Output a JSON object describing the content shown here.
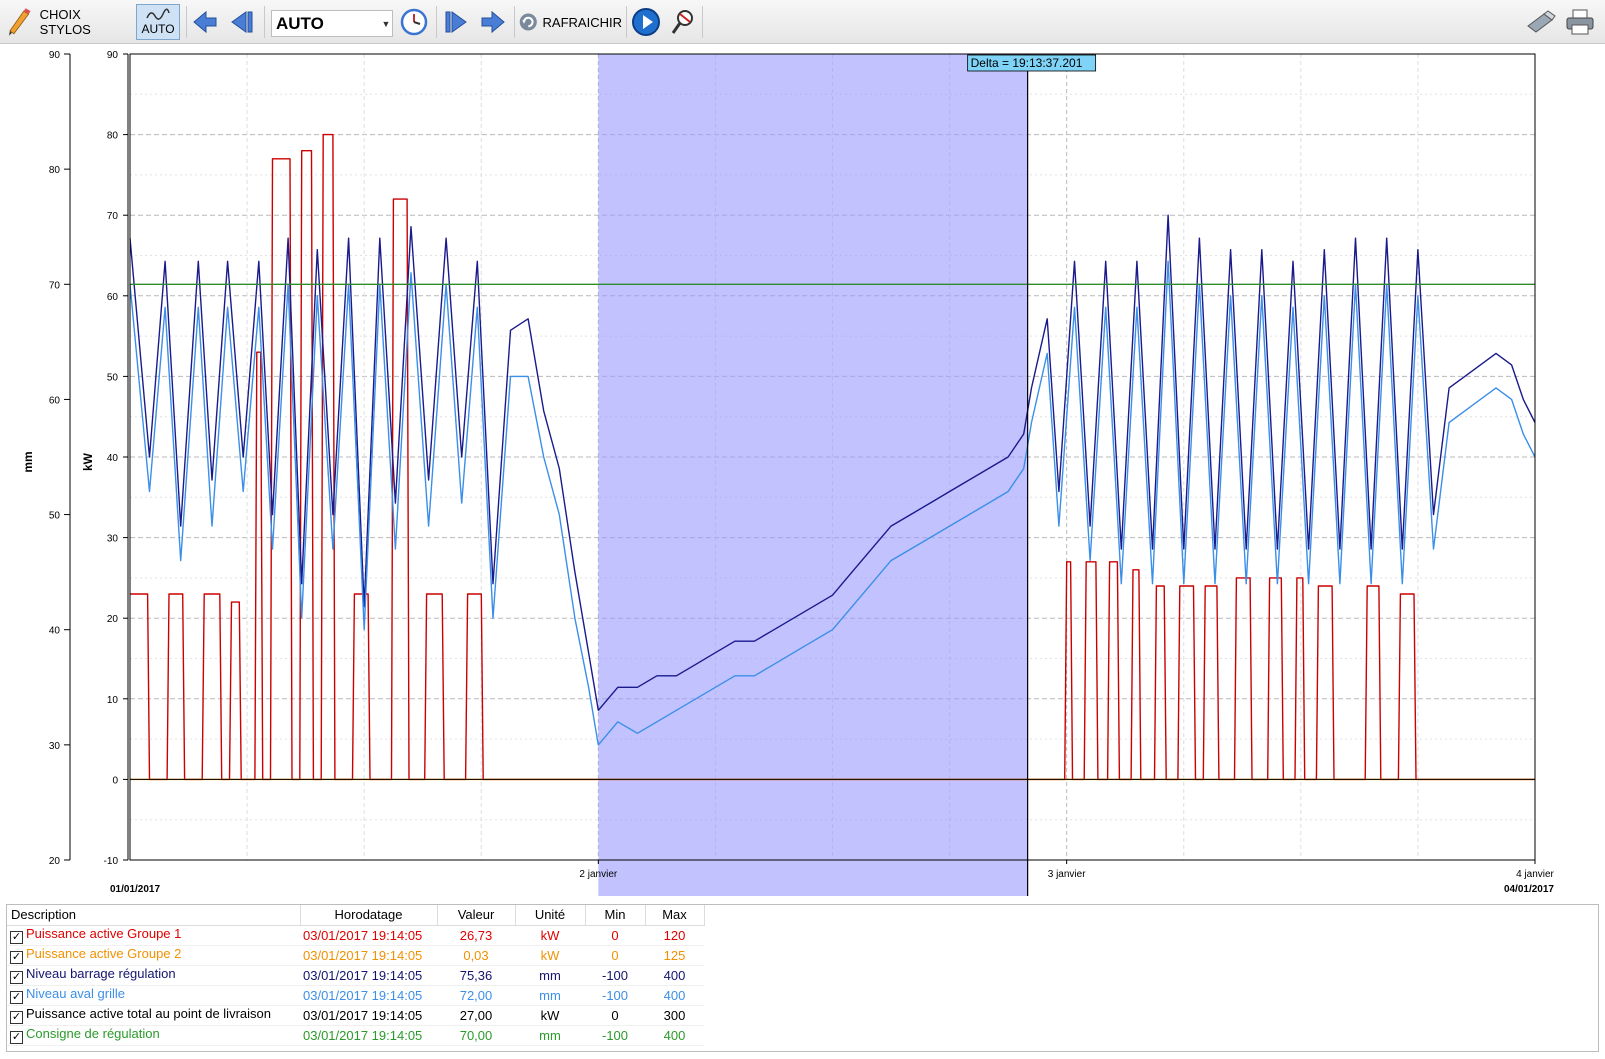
{
  "toolbar": {
    "choose_pens_label": "CHOIX STYLOS",
    "auto_label": "AUTO",
    "mode_value": "AUTO",
    "refresh_label": "RAFRAICHIR"
  },
  "chart_data": {
    "type": "line",
    "title": "",
    "left_axis": {
      "label": "mm",
      "ticks": [
        20,
        30,
        40,
        50,
        60,
        70,
        80,
        90
      ],
      "range": [
        20,
        90
      ]
    },
    "right_axis": {
      "label": "kW",
      "ticks": [
        -10,
        0,
        10,
        20,
        30,
        40,
        50,
        60,
        70,
        80,
        90
      ],
      "range": [
        -10,
        90
      ]
    },
    "x_range_hours": [
      0,
      72
    ],
    "x_tick_labels": [
      "2 janvier",
      "3 janvier",
      "4 janvier"
    ],
    "start_label": "01/01/2017",
    "end_label": "04/01/2017",
    "delta_label": "Delta = 19:13:37.201",
    "selection_hours": [
      24,
      46.0
    ],
    "grid": true,
    "series": [
      {
        "name": "Puissance active Groupe 1",
        "color": "#cc0000",
        "unit": "kW",
        "x": [
          0,
          0.9,
          1,
          1.9,
          2,
          2.7,
          2.8,
          3.7,
          3.8,
          4.6,
          4.7,
          5.1,
          5.2,
          5.6,
          5.7,
          6.4,
          6.5,
          6.7,
          6.8,
          7.2,
          7.3,
          8.2,
          8.3,
          8.7,
          8.8,
          9.3,
          9.4,
          9.8,
          9.9,
          10.4,
          10.5,
          11.4,
          11.5,
          12.2,
          12.3,
          13.4,
          13.5,
          14.2,
          14.3,
          15.1,
          15.2,
          16.0,
          16.1,
          17.2,
          17.3,
          18.0,
          18.1,
          18.4,
          18.5,
          47.9,
          48.0,
          48.2,
          48.3,
          48.9,
          49.0,
          49.5,
          49.6,
          50.1,
          50.2,
          50.6,
          50.7,
          51.3,
          51.4,
          51.7,
          51.8,
          52.5,
          52.6,
          53.0,
          53.1,
          53.7,
          53.8,
          54.5,
          54.6,
          55.0,
          55.1,
          55.7,
          55.8,
          56.6,
          56.7,
          57.4,
          57.5,
          58.3,
          58.4,
          59.0,
          59.1,
          59.7,
          59.8,
          60.1,
          60.2,
          60.8,
          60.9,
          61.6,
          61.7,
          62.5,
          62.6,
          63.3,
          63.4,
          64.0,
          64.1,
          65.0,
          65.1,
          65.8,
          65.9,
          66.6,
          66.7,
          72
        ],
        "y": [
          23,
          23,
          0,
          0,
          23,
          23,
          0,
          0,
          23,
          23,
          0,
          0,
          22,
          22,
          0,
          0,
          53,
          53,
          0,
          0,
          77,
          77,
          0,
          0,
          78,
          78,
          0,
          0,
          80,
          80,
          0,
          0,
          23,
          23,
          0,
          0,
          72,
          72,
          0,
          0,
          23,
          23,
          0,
          0,
          23,
          23,
          0,
          0,
          0,
          0,
          27,
          27,
          0,
          0,
          27,
          27,
          0,
          0,
          27,
          27,
          0,
          0,
          26,
          26,
          0,
          0,
          24,
          24,
          0,
          0,
          24,
          24,
          0,
          0,
          24,
          24,
          0,
          0,
          25,
          25,
          0,
          0,
          25,
          25,
          0,
          0,
          25,
          25,
          0,
          0,
          24,
          24,
          0,
          0,
          0,
          0,
          24,
          24,
          0,
          0,
          23,
          23,
          0,
          0,
          0,
          0
        ]
      },
      {
        "name": "Puissance active Groupe 2",
        "color": "#ff9900",
        "unit": "kW",
        "x": [
          0,
          72
        ],
        "y": [
          0,
          0
        ]
      },
      {
        "name": "Niveau barrage régulation",
        "color": "#1a1a8c",
        "unit": "mm",
        "x": [
          0,
          1,
          1.8,
          2.6,
          3.5,
          4.2,
          5.0,
          5.8,
          6.6,
          7.3,
          8.1,
          8.8,
          9.6,
          10.4,
          11.2,
          12.0,
          12.8,
          13.6,
          14.4,
          15.3,
          16.2,
          17.0,
          17.8,
          18.6,
          19.5,
          20.4,
          21.2,
          22.0,
          22.8,
          23.5,
          24.0,
          25,
          26,
          27,
          28,
          29,
          30,
          31,
          32,
          33,
          34,
          35,
          36,
          37,
          38,
          39,
          40,
          41,
          42,
          43,
          44,
          45,
          45.8,
          46.2,
          47.0,
          47.6,
          48.4,
          49.2,
          50.0,
          50.8,
          51.6,
          52.4,
          53.2,
          54.0,
          54.8,
          55.6,
          56.4,
          57.2,
          58.0,
          58.8,
          59.6,
          60.4,
          61.2,
          62.0,
          62.8,
          63.6,
          64.4,
          65.2,
          66.0,
          66.8,
          67.6,
          68.4,
          69.2,
          70.0,
          70.8,
          71.4,
          72.0
        ],
        "y": [
          74,
          55,
          72,
          49,
          72,
          53,
          72,
          55,
          72,
          50,
          74,
          44,
          73,
          50,
          74,
          42,
          74,
          51,
          75,
          53,
          74,
          55,
          72,
          44,
          66,
          67,
          59,
          54,
          45,
          38,
          33,
          35,
          35,
          36,
          36,
          37,
          38,
          39,
          39,
          40,
          41,
          42,
          43,
          45,
          47,
          49,
          50,
          51,
          52,
          53,
          54,
          55,
          57,
          61,
          67,
          52,
          72,
          49,
          72,
          47,
          72,
          47,
          76,
          47,
          74,
          47,
          73,
          47,
          73,
          47,
          72,
          47,
          73,
          47,
          74,
          47,
          74,
          47,
          73,
          50,
          61,
          62,
          63,
          64,
          63,
          60,
          58
        ]
      },
      {
        "name": "Niveau aval grille",
        "color": "#3b8fe8",
        "unit": "mm",
        "x": [
          0,
          1,
          1.8,
          2.6,
          3.5,
          4.2,
          5.0,
          5.8,
          6.6,
          7.3,
          8.1,
          8.8,
          9.6,
          10.4,
          11.2,
          12.0,
          12.8,
          13.6,
          14.4,
          15.3,
          16.2,
          17.0,
          17.8,
          18.6,
          19.5,
          20.4,
          21.2,
          22.0,
          22.8,
          23.5,
          24.0,
          25,
          26,
          27,
          28,
          29,
          30,
          31,
          32,
          33,
          34,
          35,
          36,
          37,
          38,
          39,
          40,
          41,
          42,
          43,
          44,
          45,
          45.8,
          46.2,
          47.0,
          47.6,
          48.4,
          49.2,
          50.0,
          50.8,
          51.6,
          52.4,
          53.2,
          54.0,
          54.8,
          55.6,
          56.4,
          57.2,
          58.0,
          58.8,
          59.6,
          60.4,
          61.2,
          62.0,
          62.8,
          63.6,
          64.4,
          65.2,
          66.0,
          66.8,
          67.6,
          68.4,
          69.2,
          70.0,
          70.8,
          71.4,
          72.0
        ],
        "y": [
          70,
          52,
          68,
          46,
          68,
          49,
          68,
          52,
          68,
          47,
          70,
          41,
          69,
          47,
          70,
          40,
          70,
          47,
          71,
          49,
          70,
          51,
          68,
          41,
          62,
          62,
          55,
          50,
          41,
          35,
          30,
          32,
          31,
          32,
          33,
          34,
          35,
          36,
          36,
          37,
          38,
          39,
          40,
          42,
          44,
          46,
          47,
          48,
          49,
          50,
          51,
          52,
          54,
          58,
          64,
          49,
          68,
          46,
          68,
          44,
          68,
          44,
          72,
          44,
          70,
          44,
          69,
          44,
          69,
          44,
          68,
          44,
          69,
          44,
          70,
          44,
          70,
          44,
          69,
          47,
          58,
          59,
          60,
          61,
          60,
          57,
          55
        ]
      },
      {
        "name": "Puissance active total au point de livraison",
        "color": "#000000",
        "unit": "kW",
        "x": [
          0,
          72
        ],
        "y": [
          0,
          0
        ]
      },
      {
        "name": "Consigne de régulation",
        "color": "#2e8b2e",
        "unit": "mm",
        "x": [
          0,
          72
        ],
        "y": [
          70,
          70
        ]
      }
    ]
  },
  "table": {
    "headers": {
      "description": "Description",
      "timestamp": "Horodatage",
      "value": "Valeur",
      "unit": "Unité",
      "min": "Min",
      "max": "Max"
    },
    "rows": [
      {
        "description": "Puissance active Groupe 1",
        "timestamp": "03/01/2017 19:14:05",
        "value": "26,73",
        "unit": "kW",
        "min": "0",
        "max": "120",
        "color": "#e00000",
        "checked": true
      },
      {
        "description": "Puissance active Groupe 2",
        "timestamp": "03/01/2017 19:14:05",
        "value": "0,03",
        "unit": "kW",
        "min": "0",
        "max": "125",
        "color": "#f29100",
        "checked": true
      },
      {
        "description": "Niveau barrage régulation",
        "timestamp": "03/01/2017 19:14:05",
        "value": "75,36",
        "unit": "mm",
        "min": "-100",
        "max": "400",
        "color": "#141470",
        "checked": true
      },
      {
        "description": "Niveau aval grille",
        "timestamp": "03/01/2017 19:14:05",
        "value": "72,00",
        "unit": "mm",
        "min": "-100",
        "max": "400",
        "color": "#3b8fe8",
        "checked": true
      },
      {
        "description": "Puissance active total au point de livraison",
        "timestamp": "03/01/2017 19:14:05",
        "value": "27,00",
        "unit": "kW",
        "min": "0",
        "max": "300",
        "color": "#000000",
        "checked": true
      },
      {
        "description": "Consigne de régulation",
        "timestamp": "03/01/2017 19:14:05",
        "value": "70,00",
        "unit": "mm",
        "min": "-100",
        "max": "400",
        "color": "#2a9a2a",
        "checked": true
      }
    ]
  }
}
